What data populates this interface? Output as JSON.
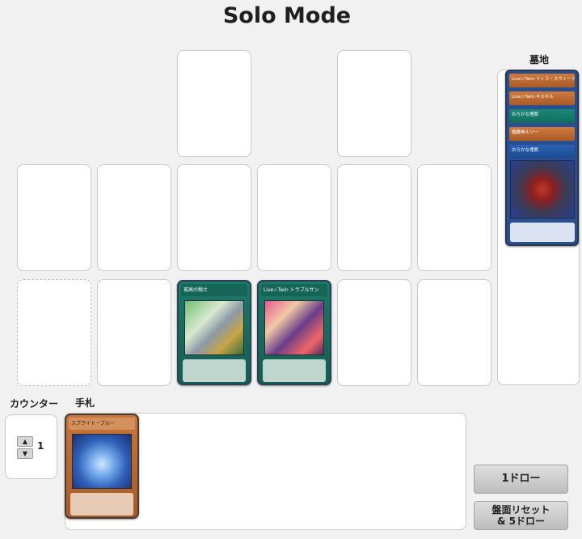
{
  "title": "Solo Mode",
  "graveyard": {
    "label": "墓地",
    "cards": [
      {
        "type": "monster",
        "name": "Live☆Twin リィラ・スウィート"
      },
      {
        "type": "monster",
        "name": "Live☆Twin キスキル"
      },
      {
        "type": "spell",
        "name": "おろかな埋葬"
      },
      {
        "type": "monster",
        "name": "魔轟神ルリー"
      },
      {
        "type": "bottom",
        "name": "おろかな埋葬"
      }
    ]
  },
  "field": {
    "spell_zone_card_1": {
      "type": "spell",
      "name": "孤高の騎士"
    },
    "spell_zone_card_2": {
      "type": "spell",
      "name": "Live☆Twin トラブルサン"
    }
  },
  "counter": {
    "label": "カウンター",
    "value": "1",
    "up_symbol": "▲",
    "down_symbol": "▼"
  },
  "hand": {
    "label": "手札",
    "cards": [
      {
        "type": "monster",
        "name": "スプライト・ブルー"
      }
    ]
  },
  "buttons": {
    "draw_one": "1ドロー",
    "reset_draw_five": "盤面リセット\n& 5ドロー"
  }
}
